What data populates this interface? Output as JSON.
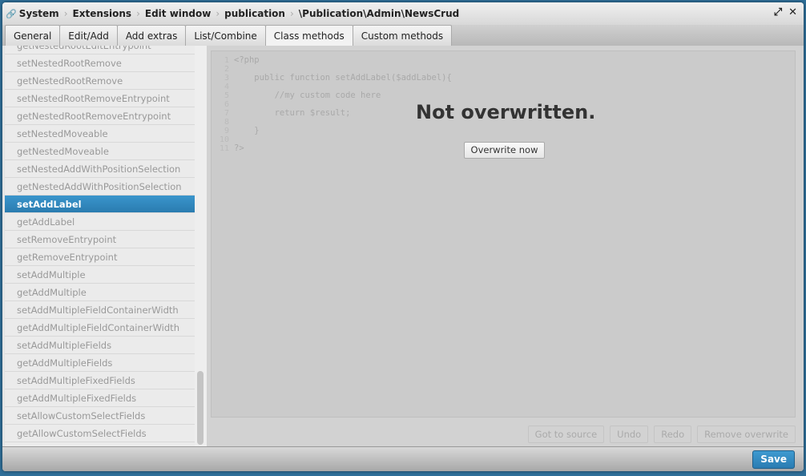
{
  "breadcrumb": [
    "System",
    "Extensions",
    "Edit window",
    "publication",
    "\\Publication\\Admin\\NewsCrud"
  ],
  "tabs": [
    "General",
    "Edit/Add",
    "Add extras",
    "List/Combine",
    "Class methods",
    "Custom methods"
  ],
  "active_tab": "Class methods",
  "methods": [
    "getNestedRootEditEntrypoint",
    "setNestedRootRemove",
    "getNestedRootRemove",
    "setNestedRootRemoveEntrypoint",
    "getNestedRootRemoveEntrypoint",
    "setNestedMoveable",
    "getNestedMoveable",
    "setNestedAddWithPositionSelection",
    "getNestedAddWithPositionSelection",
    "setAddLabel",
    "getAddLabel",
    "setRemoveEntrypoint",
    "getRemoveEntrypoint",
    "setAddMultiple",
    "getAddMultiple",
    "setAddMultipleFieldContainerWidth",
    "getAddMultipleFieldContainerWidth",
    "setAddMultipleFields",
    "getAddMultipleFields",
    "setAddMultipleFixedFields",
    "getAddMultipleFixedFields",
    "setAllowCustomSelectFields",
    "getAllowCustomSelectFields"
  ],
  "selected_method": "setAddLabel",
  "code_lines": [
    "<?php",
    "",
    "    public function setAddLabel($addLabel){",
    "",
    "        //my custom code here",
    "",
    "        return $result;",
    "",
    "    }",
    "",
    "?>"
  ],
  "line_numbers": "1\n2\n3\n4\n5\n6\n7\n8\n9\n10\n11",
  "status": "Not overwritten.",
  "overwrite_button": "Overwrite now",
  "actions": [
    "Got to source",
    "Undo",
    "Redo",
    "Remove overwrite"
  ],
  "save_label": "Save"
}
